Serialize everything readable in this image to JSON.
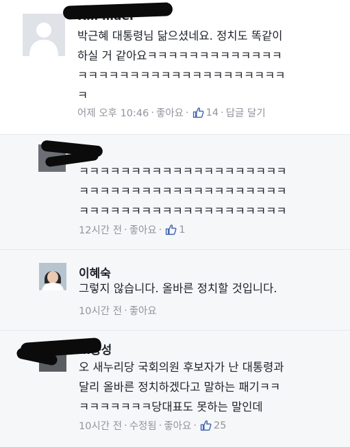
{
  "comments": [
    {
      "name": "R… …ael",
      "lines": [
        "박근혜 대통령님 닮으셨네요. 정치도 똑같이",
        "하실 거 같아요ㅋㅋㅋㅋㅋㅋㅋㅋㅋㅋㅋㅋㅋ",
        "ㅋㅋㅋㅋㅋㅋㅋㅋㅋㅋㅋㅋㅋㅋㅋㅋㅋㅋㅋㅋ",
        "ㅋ"
      ],
      "time": "어제 오후 10:46",
      "like": "좋아요",
      "likes": "14",
      "reply": "답글 달기"
    },
    {
      "lines": [
        "ㅋㅋㅋㅋㅋㅋㅋㅋㅋㅋㅋㅋㅋㅋㅋㅋㅋㅋㅋㅋ",
        "ㅋㅋㅋㅋㅋㅋㅋㅋㅋㅋㅋㅋㅋㅋㅋㅋㅋㅋㅋㅋ",
        "ㅋㅋㅋㅋㅋㅋㅋㅋㅋㅋㅋㅋㅋㅋㅋㅋㅋㅋㅋㅋ"
      ],
      "time": "12시간 전",
      "like": "좋아요",
      "likes": "1"
    },
    {
      "name": "이혜숙",
      "lines": [
        "그렇지 않습니다. 올바른 정치할 것입니다."
      ],
      "time": "10시간 전",
      "like": "좋아요"
    },
    {
      "name": "…동성",
      "lines": [
        "오 새누리당 국회의원 후보자가 난 대통령과",
        "달리 올바른 정치하겠다고 말하는 패기ㅋㅋ",
        "ㅋㅋㅋㅋㅋㅋㅋ당대표도 못하는 말인데"
      ],
      "time": "10시간 전",
      "edited": "수정됨",
      "like": "좋아요",
      "likes": "25"
    }
  ],
  "icons": {
    "like": "thumbs-up-icon",
    "default_avatar": "default-profile-icon"
  },
  "colors": {
    "meta": "#90949c",
    "link_blue": "#4267b2",
    "reply_bg": "#f6f7f9"
  }
}
